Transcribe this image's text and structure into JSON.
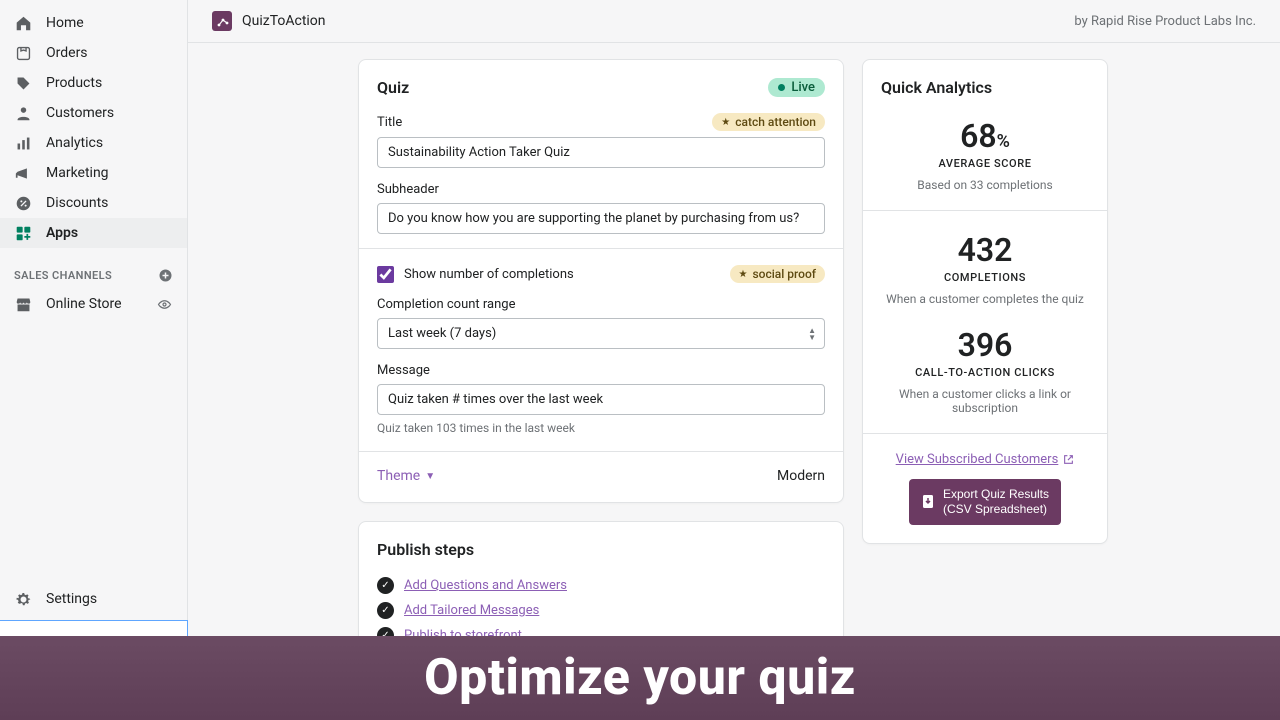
{
  "topbar": {
    "app_name": "QuizToAction",
    "by_line": "by Rapid Rise Product Labs Inc."
  },
  "sidebar": {
    "items": [
      {
        "label": "Home"
      },
      {
        "label": "Orders"
      },
      {
        "label": "Products"
      },
      {
        "label": "Customers"
      },
      {
        "label": "Analytics"
      },
      {
        "label": "Marketing"
      },
      {
        "label": "Discounts"
      },
      {
        "label": "Apps"
      }
    ],
    "channels_label": "SALES CHANNELS",
    "channels": [
      {
        "label": "Online Store"
      }
    ],
    "settings_label": "Settings"
  },
  "quiz": {
    "card_title": "Quiz",
    "live_label": "Live",
    "title_label": "Title",
    "tag_attention": "catch attention",
    "title_value": "Sustainability Action Taker Quiz",
    "subheader_label": "Subheader",
    "subheader_value": "Do you know how you are supporting the planet by purchasing from us?",
    "show_completions_label": "Show number of completions",
    "tag_social": "social proof",
    "range_label": "Completion count range",
    "range_value": "Last week (7 days)",
    "message_label": "Message",
    "message_value": "Quiz taken # times over the last week",
    "helper": "Quiz taken 103 times in the last week",
    "theme_label": "Theme",
    "theme_value": "Modern"
  },
  "publish": {
    "title": "Publish steps",
    "steps": [
      {
        "label": "Add Questions and Answers"
      },
      {
        "label": "Add Tailored Messages"
      },
      {
        "label": "Publish to storefront"
      }
    ]
  },
  "analytics": {
    "title": "Quick Analytics",
    "avg_value": "68",
    "avg_pct": "%",
    "avg_label": "AVERAGE SCORE",
    "avg_sub": "Based on 33 completions",
    "comp_value": "432",
    "comp_label": "COMPLETIONS",
    "comp_sub": "When a customer completes the quiz",
    "cta_value": "396",
    "cta_label": "CALL-TO-ACTION CLICKS",
    "cta_sub": "When a customer clicks a link or subscription",
    "view_link": "View Subscribed Customers",
    "export_line1": "Export Quiz Results",
    "export_line2": "(CSV Spreadsheet)"
  },
  "banner": {
    "text": "Optimize your quiz"
  }
}
